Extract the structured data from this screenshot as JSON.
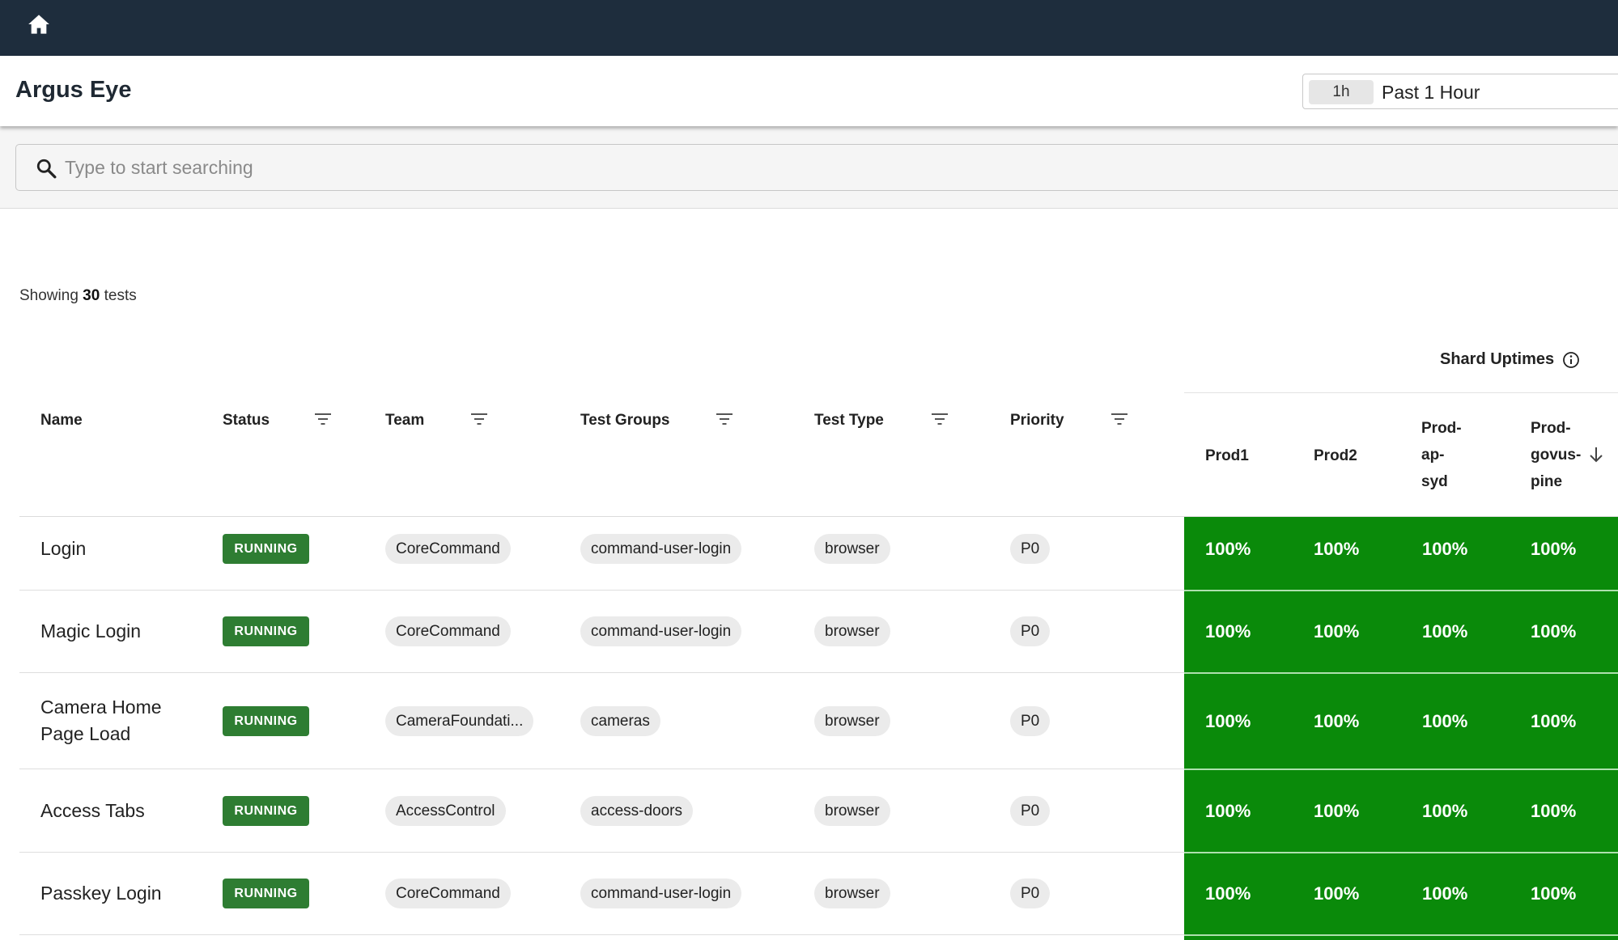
{
  "app": {
    "title": "Argus Eye"
  },
  "time_range": {
    "chip": "1h",
    "label": "Past 1 Hour"
  },
  "search": {
    "placeholder": "Type to start searching",
    "value": ""
  },
  "summary": {
    "prefix": "Showing",
    "count": "30",
    "suffix": "tests"
  },
  "shard_uptimes": {
    "title": "Shard Uptimes"
  },
  "columns": {
    "name": "Name",
    "status": "Status",
    "team": "Team",
    "test_groups": "Test Groups",
    "test_type": "Test Type",
    "priority": "Priority"
  },
  "shards": [
    {
      "line1": "Prod1",
      "line2": "",
      "line3": ""
    },
    {
      "line1": "Prod2",
      "line2": "",
      "line3": ""
    },
    {
      "line1": "Prod-",
      "line2": "ap-",
      "line3": "syd"
    },
    {
      "line1": "Prod-",
      "line2": "govus-",
      "line3": "pine"
    }
  ],
  "rows": [
    {
      "name_line1": "Login",
      "name_line2": "",
      "status": "RUNNING",
      "team": "CoreCommand",
      "test_group": "command-user-login",
      "test_type": "browser",
      "priority": "P0",
      "uptimes": [
        "100%",
        "100%",
        "100%",
        "100%"
      ]
    },
    {
      "name_line1": "Magic Login",
      "name_line2": "",
      "status": "RUNNING",
      "team": "CoreCommand",
      "test_group": "command-user-login",
      "test_type": "browser",
      "priority": "P0",
      "uptimes": [
        "100%",
        "100%",
        "100%",
        "100%"
      ]
    },
    {
      "name_line1": "Camera Home",
      "name_line2": "Page Load",
      "status": "RUNNING",
      "team": "CameraFoundati...",
      "test_group": "cameras",
      "test_type": "browser",
      "priority": "P0",
      "uptimes": [
        "100%",
        "100%",
        "100%",
        "100%"
      ]
    },
    {
      "name_line1": "Access Tabs",
      "name_line2": "",
      "status": "RUNNING",
      "team": "AccessControl",
      "test_group": "access-doors",
      "test_type": "browser",
      "priority": "P0",
      "uptimes": [
        "100%",
        "100%",
        "100%",
        "100%"
      ]
    },
    {
      "name_line1": "Passkey Login",
      "name_line2": "",
      "status": "RUNNING",
      "team": "CoreCommand",
      "test_group": "command-user-login",
      "test_type": "browser",
      "priority": "P0",
      "uptimes": [
        "100%",
        "100%",
        "100%",
        "100%"
      ]
    }
  ],
  "colors": {
    "topbar": "#1e2d3d",
    "running_badge": "#2e7d32",
    "uptime_full": "#0a8a0a"
  }
}
